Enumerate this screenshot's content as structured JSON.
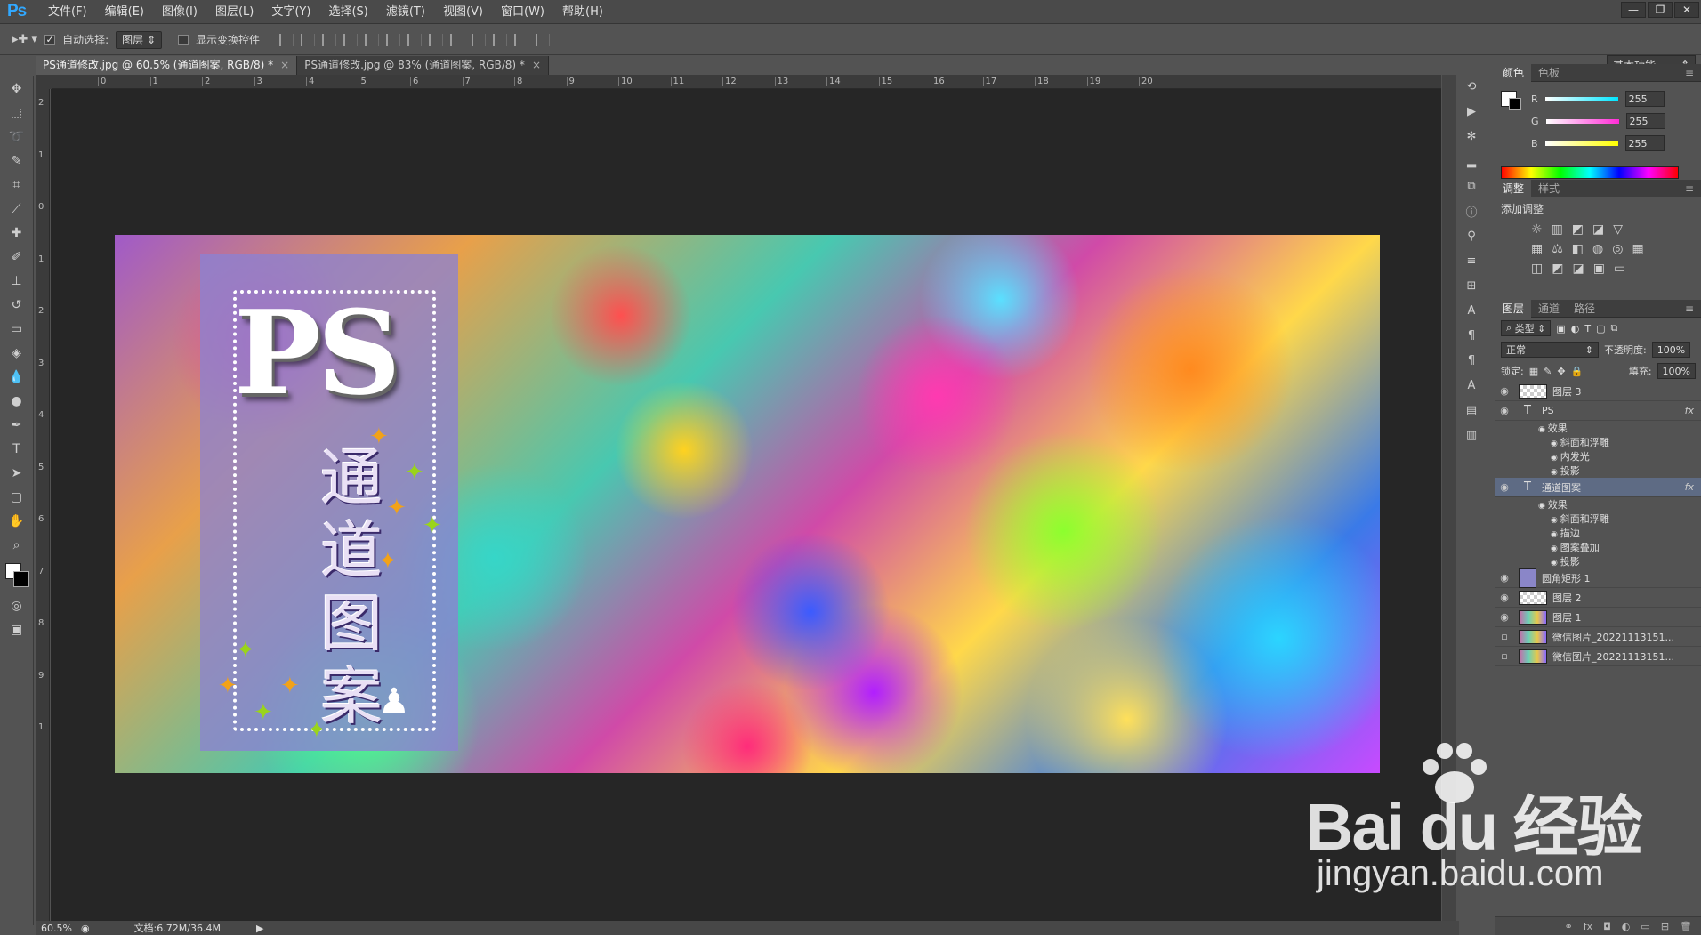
{
  "app": {
    "logo": "Ps"
  },
  "menu": [
    "文件(F)",
    "编辑(E)",
    "图像(I)",
    "图层(L)",
    "文字(Y)",
    "选择(S)",
    "滤镜(T)",
    "视图(V)",
    "窗口(W)",
    "帮助(H)"
  ],
  "window_controls": [
    "—",
    "❐",
    "✕"
  ],
  "options": {
    "auto_select_label": "自动选择:",
    "auto_select_value": "图层",
    "show_transform_label": "显示变换控件",
    "workspace": "基本功能"
  },
  "tabs": [
    {
      "label": "PS通道修改.jpg @ 60.5% (通道图案, RGB/8) *",
      "close": "×"
    },
    {
      "label": "PS通道修改.jpg @ 83% (通道图案, RGB/8) *",
      "close": "×"
    }
  ],
  "ruler_h": [
    "0",
    "1",
    "2",
    "3",
    "4",
    "5",
    "6",
    "7",
    "8",
    "9",
    "10",
    "11",
    "12",
    "13",
    "14",
    "15",
    "16",
    "17",
    "18",
    "19",
    "20"
  ],
  "ruler_v": [
    "2",
    "1",
    "0",
    "1",
    "2",
    "3",
    "4",
    "5",
    "6",
    "7",
    "8",
    "9",
    "1"
  ],
  "canvas": {
    "big_text": "PS",
    "cn_text": "通道图案"
  },
  "color_panel": {
    "tabs": [
      "颜色",
      "色板"
    ],
    "channels": [
      {
        "label": "R",
        "value": "255",
        "color": "#00e5ff"
      },
      {
        "label": "G",
        "value": "255",
        "color": "#ff2bd6"
      },
      {
        "label": "B",
        "value": "255",
        "color": "#ffff00"
      }
    ]
  },
  "adjust_panel": {
    "tabs": [
      "调整",
      "样式"
    ],
    "title": "添加调整"
  },
  "layers_panel": {
    "tabs": [
      "图层",
      "通道",
      "路径"
    ],
    "kind": "类型",
    "blend": "正常",
    "opacity_label": "不透明度:",
    "opacity": "100%",
    "lock_label": "锁定:",
    "fill_label": "填充:",
    "fill": "100%",
    "rows": [
      {
        "name": "图层 3",
        "type": "raster",
        "visible": true
      },
      {
        "name": "PS",
        "type": "text",
        "fx": "fx",
        "visible": true
      },
      {
        "name": "效果",
        "type": "effects",
        "sub": 1
      },
      {
        "name": "斜面和浮雕",
        "type": "effect",
        "sub": 2
      },
      {
        "name": "内发光",
        "type": "effect",
        "sub": 2
      },
      {
        "name": "投影",
        "type": "effect",
        "sub": 2
      },
      {
        "name": "通道图案",
        "type": "text",
        "fx": "fx",
        "visible": true,
        "selected": true
      },
      {
        "name": "效果",
        "type": "effects",
        "sub": 1
      },
      {
        "name": "斜面和浮雕",
        "type": "effect",
        "sub": 2
      },
      {
        "name": "描边",
        "type": "effect",
        "sub": 2
      },
      {
        "name": "图案叠加",
        "type": "effect",
        "sub": 2
      },
      {
        "name": "投影",
        "type": "effect",
        "sub": 2
      },
      {
        "name": "圆角矩形 1",
        "type": "shape",
        "visible": true
      },
      {
        "name": "图层 2",
        "type": "raster",
        "visible": true
      },
      {
        "name": "图层 1",
        "type": "image",
        "visible": true
      },
      {
        "name": "微信图片_20221113151...",
        "type": "image",
        "visible": false
      },
      {
        "name": "微信图片_20221113151...",
        "type": "image",
        "visible": false
      }
    ]
  },
  "status": {
    "zoom": "60.5%",
    "doc": "文档:6.72M/36.4M"
  },
  "watermark": {
    "main": "Bai du 经验",
    "sub": "jingyan.baidu.com"
  }
}
